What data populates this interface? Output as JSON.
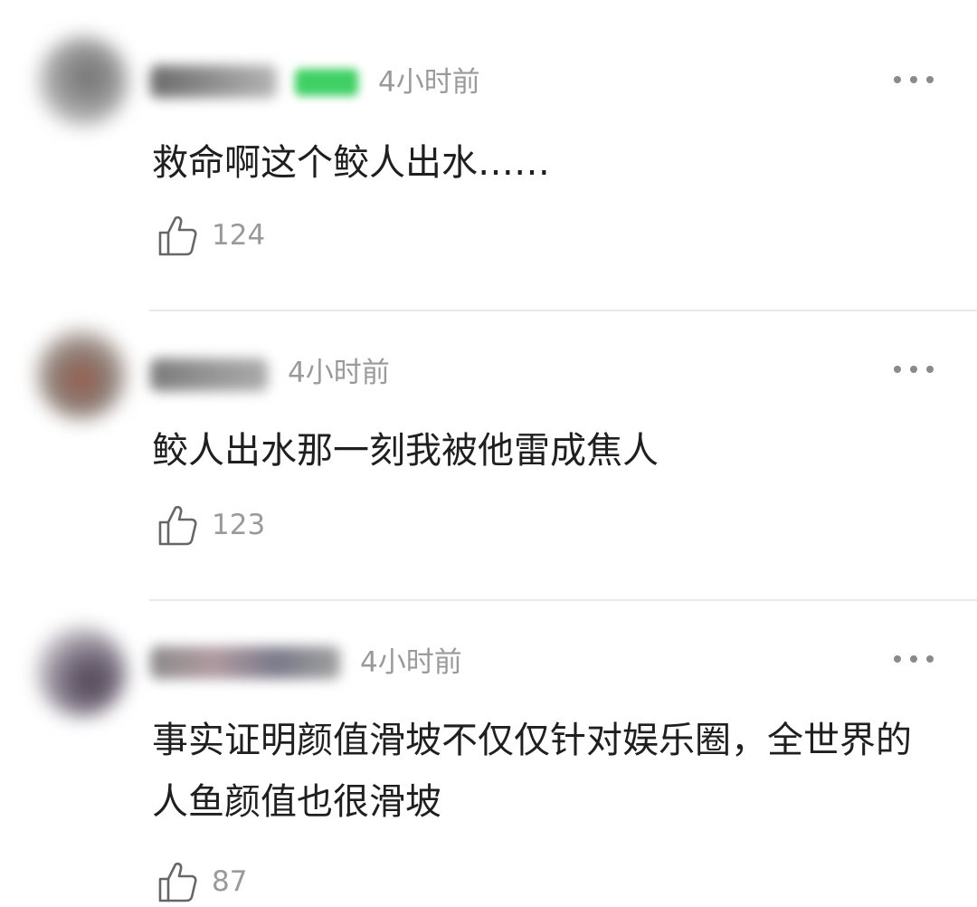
{
  "comments": [
    {
      "time": "4小时前",
      "text": "救命啊这个鲛人出水……",
      "likes": "124",
      "has_badge": true,
      "badge_color": "#3fd064"
    },
    {
      "time": "4小时前",
      "text": "鲛人出水那一刻我被他雷成焦人",
      "likes": "123",
      "has_badge": false
    },
    {
      "time": "4小时前",
      "text": "事实证明颜值滑坡不仅仅针对娱乐圈，全世界的人鱼颜值也很滑坡",
      "likes": "87",
      "has_badge": false
    }
  ],
  "icons": {
    "like": "thumbs-up-icon",
    "more": "more-dots-icon",
    "avatar": "avatar"
  },
  "colors": {
    "muted_text": "#9a9a9a",
    "body_text": "#1f1f1f",
    "divider": "#e9e9e9"
  }
}
